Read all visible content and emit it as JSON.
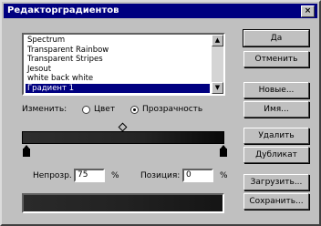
{
  "window": {
    "title": "Редакторградиентов",
    "close_glyph": "×"
  },
  "gradients": {
    "items": [
      "Spectrum",
      "Transparent Rainbow",
      "Transparent Stripes",
      "Jesout",
      "white back white",
      "Градиент 1"
    ],
    "selected_index": 5
  },
  "buttons": {
    "ok": "Да",
    "cancel": "Отменить",
    "new": "Новые...",
    "rename": "Имя...",
    "delete": "Удалить",
    "duplicate": "Дубликат",
    "load": "Загрузить...",
    "save": "Сохранить..."
  },
  "adjust": {
    "label": "Изменить:",
    "options": [
      "Цвет",
      "Прозрачность"
    ],
    "selected": "Прозрачность"
  },
  "fields": {
    "opacity_label": "Непрозр.",
    "opacity_value": "75",
    "opacity_unit": "%",
    "location_label": "Позиция:",
    "location_value": "0",
    "location_unit": "%"
  },
  "icons": {
    "scroll_up": "up-arrow",
    "scroll_down": "down-arrow"
  }
}
